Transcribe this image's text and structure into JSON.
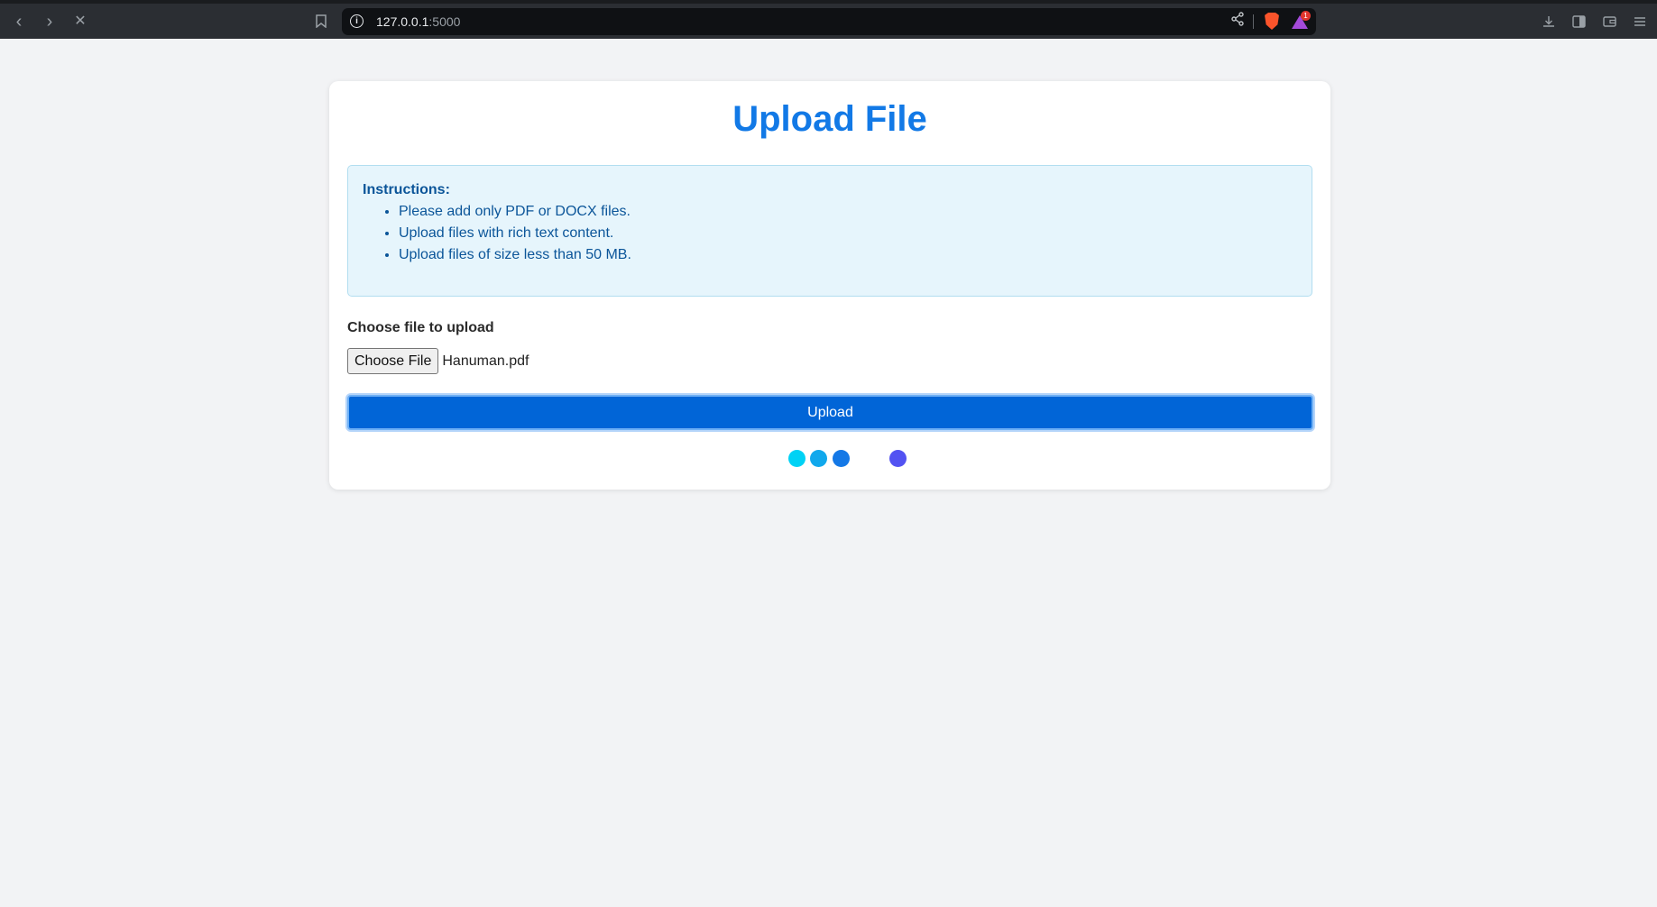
{
  "browser": {
    "url_host": "127.0.0.1",
    "url_port": ":5000",
    "rewards_badge": "1"
  },
  "page": {
    "title": "Upload File",
    "instructions": {
      "heading": "Instructions:",
      "items": [
        "Please add only PDF or DOCX files.",
        "Upload files with rich text content.",
        "Upload files of size less than 50 MB."
      ]
    },
    "file_label": "Choose file to upload",
    "file_button": "Choose File",
    "file_name": "Hanuman.pdf",
    "upload_button": "Upload",
    "loader_colors": [
      "#00d2f5",
      "#11a8ec",
      "#1478e6",
      "#5252f2"
    ]
  }
}
